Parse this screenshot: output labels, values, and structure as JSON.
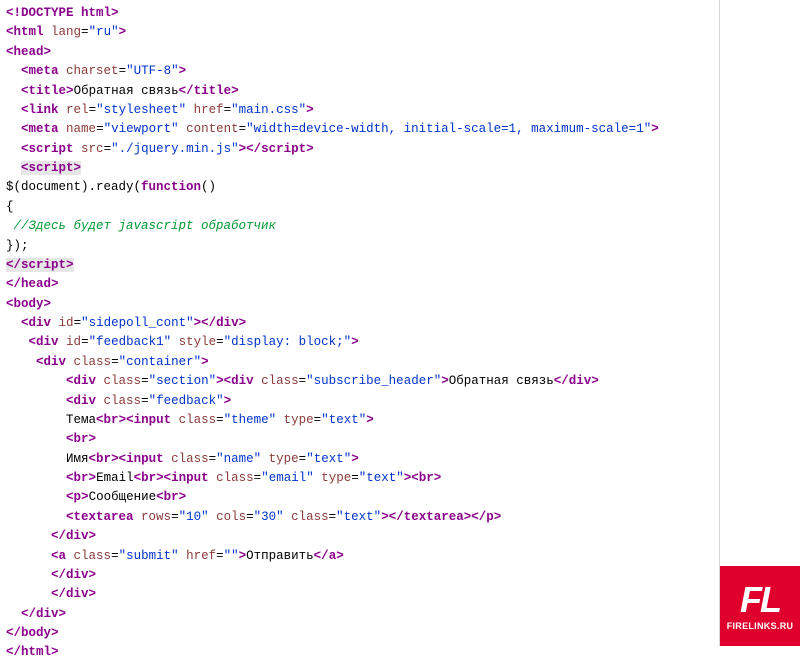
{
  "code": {
    "l1a": "<!",
    "l1b": "DOCTYPE",
    "l1c": " html",
    "l1d": ">",
    "l2a": "<",
    "l2b": "html",
    "l2c": " lang",
    "l2d": "=",
    "l2e": "\"ru\"",
    "l2f": ">",
    "l3a": "<",
    "l3b": "head",
    "l3c": ">",
    "l4a": "<",
    "l4b": "meta",
    "l4c": " charset",
    "l4d": "=",
    "l4e": "\"UTF-8\"",
    "l4f": ">",
    "l5a": "<",
    "l5b": "title",
    "l5c": ">",
    "l5t": "Обратная связь",
    "l5d": "</",
    "l5e": "title",
    "l5f": ">",
    "l6a": "<",
    "l6b": "link",
    "l6c": " rel",
    "l6d": "=",
    "l6e": "\"stylesheet\"",
    "l6f": " href",
    "l6g": "=",
    "l6h": "\"main.css\"",
    "l6i": ">",
    "l7a": "<",
    "l7b": "meta",
    "l7c": " name",
    "l7d": "=",
    "l7e": "\"viewport\"",
    "l7f": " content",
    "l7g": "=",
    "l7h": "\"width=device-width, initial-scale=1, maximum-scale=1\"",
    "l7i": ">",
    "l8a": "<",
    "l8b": "script",
    "l8c": " src",
    "l8d": "=",
    "l8e": "\"./jquery.min.js\"",
    "l8f": ">",
    "l8g": "</",
    "l8h": "script",
    "l8i": ">",
    "l9a": "<",
    "l9b": "script",
    "l9c": ">",
    "l10": "$(document).ready(",
    "l10b": "function",
    "l10c": "()",
    "l11": "{",
    "l12": " //Здесь будет javascript обработчик",
    "l13": "});",
    "l14a": "</",
    "l14b": "script",
    "l14c": ">",
    "l15a": "</",
    "l15b": "head",
    "l15c": ">",
    "l16a": "<",
    "l16b": "body",
    "l16c": ">",
    "l17a": "<",
    "l17b": "div",
    "l17c": " id",
    "l17d": "=",
    "l17e": "\"sidepoll_cont\"",
    "l17f": ">",
    "l17g": "</",
    "l17h": "div",
    "l17i": ">",
    "l18a": "<",
    "l18b": "div",
    "l18c": " id",
    "l18d": "=",
    "l18e": "\"feedback1\"",
    "l18f": " style",
    "l18g": "=",
    "l18h": "\"display: block;\"",
    "l18i": ">",
    "l19a": "<",
    "l19b": "div",
    "l19c": " class",
    "l19d": "=",
    "l19e": "\"container\"",
    "l19f": ">",
    "l20a": "<",
    "l20b": "div",
    "l20c": " class",
    "l20d": "=",
    "l20e": "\"section\"",
    "l20f": ">",
    "l20g": "<",
    "l20h": "div",
    "l20i": " class",
    "l20j": "=",
    "l20k": "\"subscribe_header\"",
    "l20l": ">",
    "l20t": "Обратная связь",
    "l20m": "</",
    "l20n": "div",
    "l20o": ">",
    "l21a": "<",
    "l21b": "div",
    "l21c": " class",
    "l21d": "=",
    "l21e": "\"feedback\"",
    "l21f": ">",
    "l22t": "Тема",
    "l22a": "<",
    "l22b": "br",
    "l22c": ">",
    "l22d": "<",
    "l22e": "input",
    "l22f": " class",
    "l22g": "=",
    "l22h": "\"theme\"",
    "l22i": " type",
    "l22j": "=",
    "l22k": "\"text\"",
    "l22l": ">",
    "l23a": "<",
    "l23b": "br",
    "l23c": ">",
    "l24t": "Имя",
    "l24a": "<",
    "l24b": "br",
    "l24c": ">",
    "l24d": "<",
    "l24e": "input",
    "l24f": " class",
    "l24g": "=",
    "l24h": "\"name\"",
    "l24i": " type",
    "l24j": "=",
    "l24k": "\"text\"",
    "l24l": ">",
    "l25a": "<",
    "l25b": "br",
    "l25c": ">",
    "l25t": "Email",
    "l25d": "<",
    "l25e": "br",
    "l25f": ">",
    "l25g": "<",
    "l25h": "input",
    "l25i": " class",
    "l25j": "=",
    "l25k": "\"email\"",
    "l25l": " type",
    "l25m": "=",
    "l25n": "\"text\"",
    "l25o": ">",
    "l25p": "<",
    "l25q": "br",
    "l25r": ">",
    "l26a": "<",
    "l26b": "p",
    "l26c": ">",
    "l26t": "Сообщение",
    "l26d": "<",
    "l26e": "br",
    "l26f": ">",
    "l27a": "<",
    "l27b": "textarea",
    "l27c": " rows",
    "l27d": "=",
    "l27e": "\"10\"",
    "l27f": " cols",
    "l27g": "=",
    "l27h": "\"30\"",
    "l27i": " class",
    "l27j": "=",
    "l27k": "\"text\"",
    "l27l": ">",
    "l27m": "</",
    "l27n": "textarea",
    "l27o": ">",
    "l27p": "</",
    "l27q": "p",
    "l27r": ">",
    "l28a": "</",
    "l28b": "div",
    "l28c": ">",
    "l29a": "<",
    "l29b": "a",
    "l29c": " class",
    "l29d": "=",
    "l29e": "\"submit\"",
    "l29f": " href",
    "l29g": "=",
    "l29h": "\"\"",
    "l29i": ">",
    "l29t": "Отправить",
    "l29j": "</",
    "l29k": "a",
    "l29l": ">",
    "l30a": "</",
    "l30b": "div",
    "l30c": ">",
    "l31a": "</",
    "l31b": "div",
    "l31c": ">",
    "l32a": "</",
    "l32b": "div",
    "l32c": ">",
    "l33a": "</",
    "l33b": "body",
    "l33c": ">",
    "l34a": "</",
    "l34b": "html",
    "l34c": ">"
  },
  "logo": {
    "big": "FL",
    "small": "FIRELINKS.RU"
  }
}
